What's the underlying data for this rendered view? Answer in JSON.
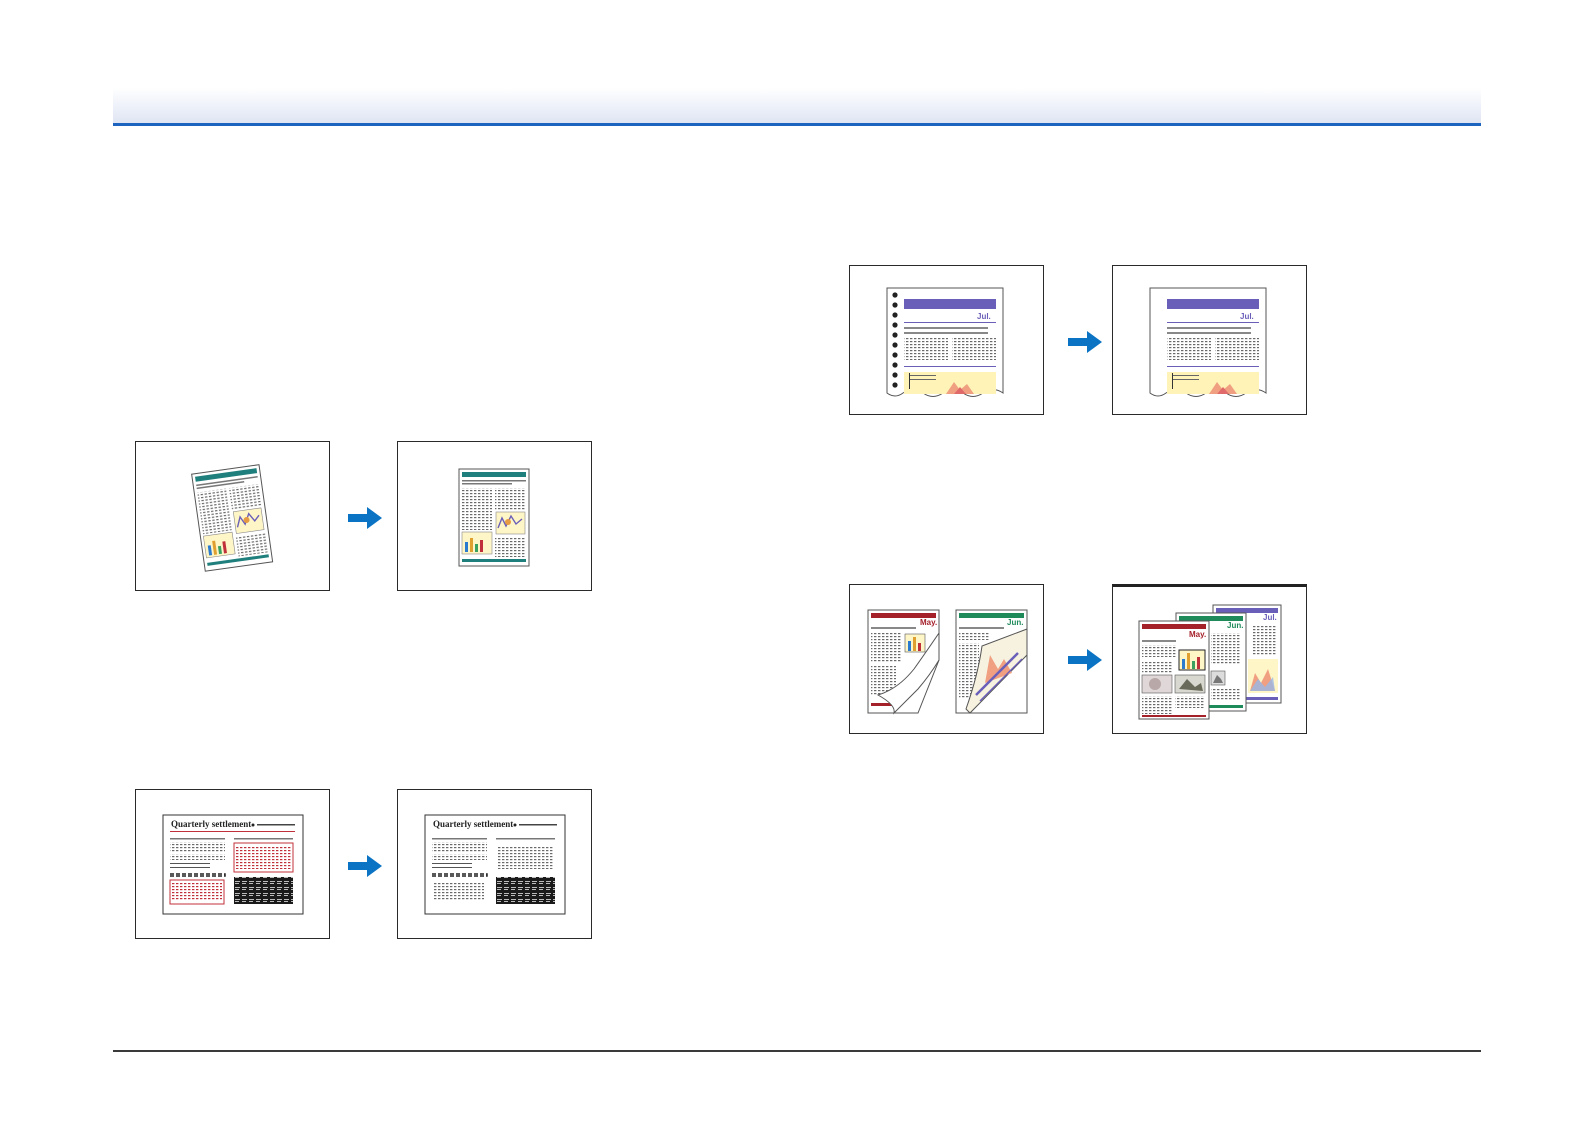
{
  "colors": {
    "accent": "#1d64c0",
    "arrow": "#0a73c4",
    "teal": "#1f7f7c",
    "purple": "#6a5fb8",
    "red": "#a5212a",
    "green": "#1f8a5a"
  },
  "deskew": {
    "icon": "arrow-right-icon"
  },
  "drop_out": {
    "title_before": "Quarterly settlement",
    "title_after": "Quarterly settlement",
    "icon": "arrow-right-icon"
  },
  "punch_hole": {
    "month_before": "Jul.",
    "month_after": "Jul.",
    "icon": "arrow-right-icon"
  },
  "folded": {
    "month_may": "May.",
    "month_jun": "Jun.",
    "icon": "arrow-right-icon"
  },
  "merged": {
    "month_may": "May.",
    "month_jun": "Jun.",
    "month_jul": "Jul."
  }
}
